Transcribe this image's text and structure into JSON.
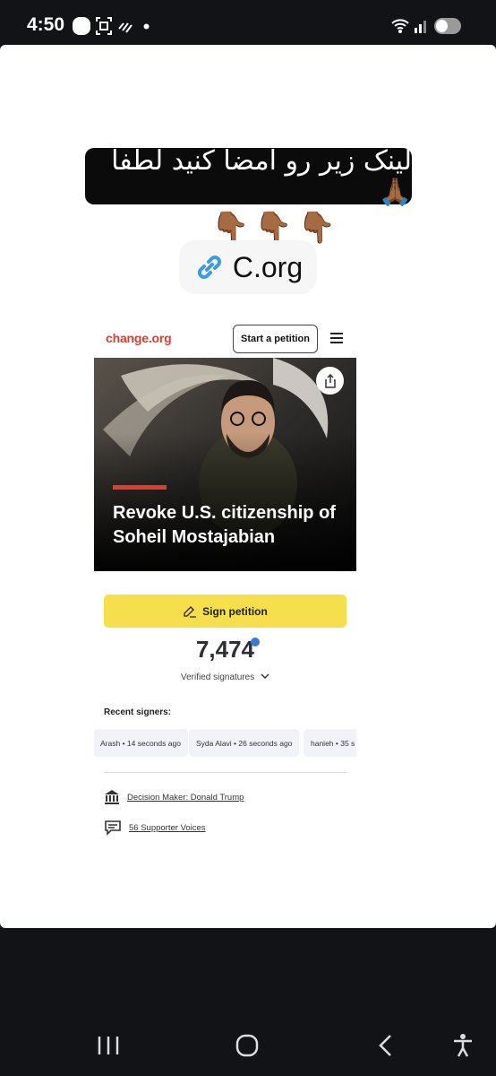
{
  "status_bar": {
    "time": "4:50"
  },
  "story": {
    "banner_text": "لینک زیر رو امضا کنید لطفاً🙏🏾",
    "pointer_emojis": "👇🏾👇🏾👇🏾",
    "link_sticker_text": "C.org"
  },
  "petition_card": {
    "logo": "change.org",
    "start_button": "Start a petition",
    "title": "Revoke U.S. citizenship of Soheil Mostajabian",
    "sign_button": "Sign petition",
    "signature_count": "7,474",
    "verified_label": "Verified signatures",
    "recent_signers_label": "Recent signers:",
    "recent_signers": [
      "Arash • 14 seconds ago",
      "Syda Alavi • 26 seconds ago",
      "hanieh • 35 s"
    ],
    "decision_maker": "Decision Maker: Donald Trump",
    "supporter_voices": "56 Supporter Voices"
  },
  "colors": {
    "brand_red": "#e13b2c",
    "sign_yellow": "#f5df4d",
    "verify_blue": "#3c78d8"
  }
}
